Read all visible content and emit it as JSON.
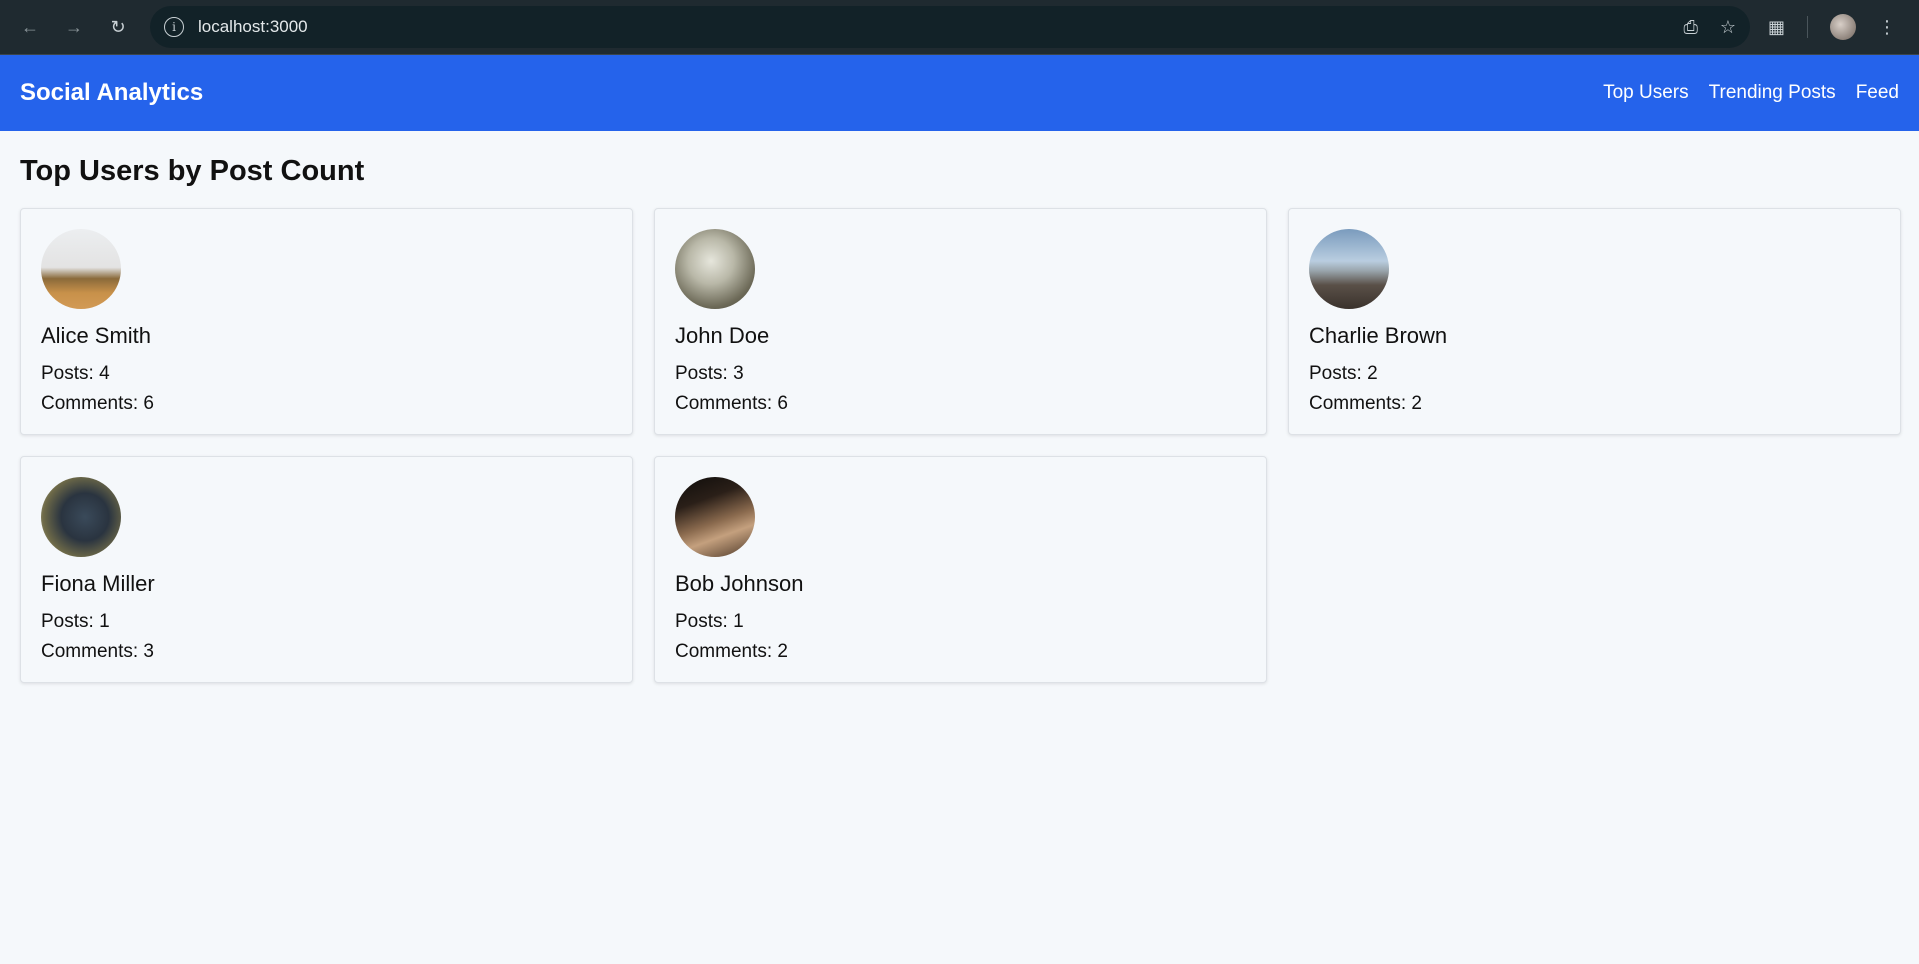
{
  "browser": {
    "url": "localhost:3000"
  },
  "header": {
    "brand": "Social Analytics",
    "nav": [
      "Top Users",
      "Trending Posts",
      "Feed"
    ]
  },
  "page": {
    "title": "Top Users by Post Count"
  },
  "users": [
    {
      "name": "Alice Smith",
      "posts": "Posts: 4",
      "comments": "Comments: 6"
    },
    {
      "name": "John Doe",
      "posts": "Posts: 3",
      "comments": "Comments: 6"
    },
    {
      "name": "Charlie Brown",
      "posts": "Posts: 2",
      "comments": "Comments: 2"
    },
    {
      "name": "Fiona Miller",
      "posts": "Posts: 1",
      "comments": "Comments: 3"
    },
    {
      "name": "Bob Johnson",
      "posts": "Posts: 1",
      "comments": "Comments: 2"
    }
  ],
  "colors": {
    "accent": "#2563eb",
    "background": "#f5f8fb"
  }
}
